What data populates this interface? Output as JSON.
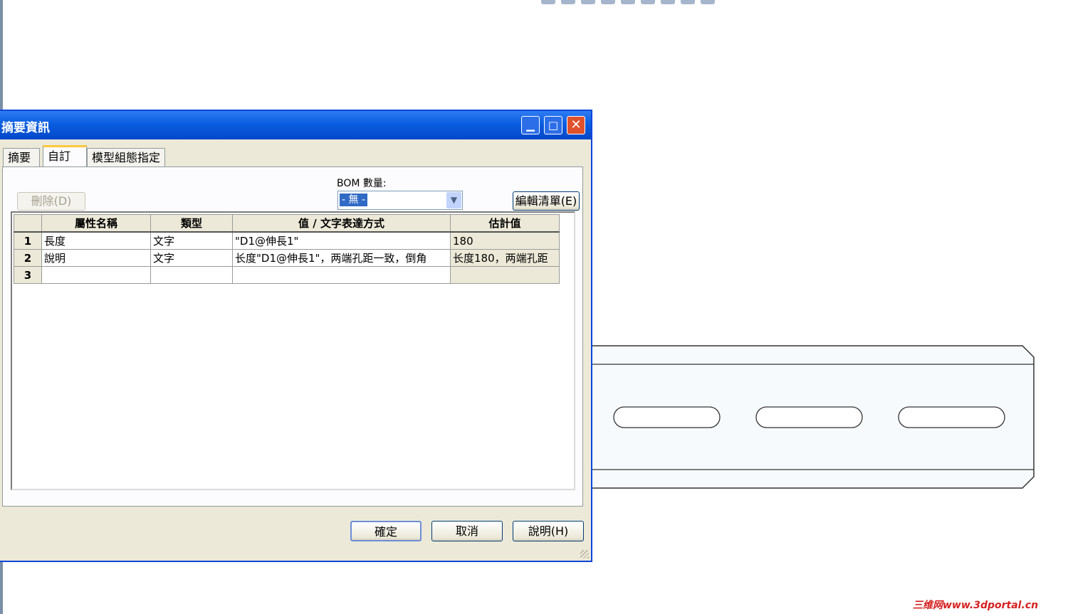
{
  "dialog": {
    "title": "摘要資訊",
    "buttons": {
      "minimize": "▁",
      "maximize": "□",
      "close": "✕"
    }
  },
  "tabs": [
    {
      "label": "摘要",
      "active": false
    },
    {
      "label": "自訂",
      "active": true
    },
    {
      "label": "模型組態指定",
      "active": false
    }
  ],
  "bom": {
    "label": "BOM 數量:",
    "selected": "- 無 -"
  },
  "toolbar_buttons": {
    "delete": "刪除(D)",
    "edit_list": "編輯清單(E)"
  },
  "grid": {
    "columns": [
      "屬性名稱",
      "類型",
      "值 / 文字表達方式",
      "估計值"
    ],
    "rows": [
      {
        "num": "1",
        "name": "長度",
        "type": "文字",
        "value": "\"D1@伸長1\"",
        "estimate": "180"
      },
      {
        "num": "2",
        "name": "說明",
        "type": "文字",
        "value": "长度\"D1@伸長1\"，两端孔距一致，倒角",
        "estimate": "长度180，两端孔距"
      },
      {
        "num": "3",
        "name": "",
        "type": "",
        "value": "",
        "estimate": ""
      }
    ]
  },
  "footer_buttons": {
    "ok": "確定",
    "cancel": "取消",
    "help": "說明(H)"
  },
  "watermark": "三维网www.3dportal.cn",
  "colors": {
    "titlebar": "#0a5ee0",
    "dialog_bg": "#ece9d8",
    "selection": "#316ac5",
    "watermark": "#d42020"
  }
}
